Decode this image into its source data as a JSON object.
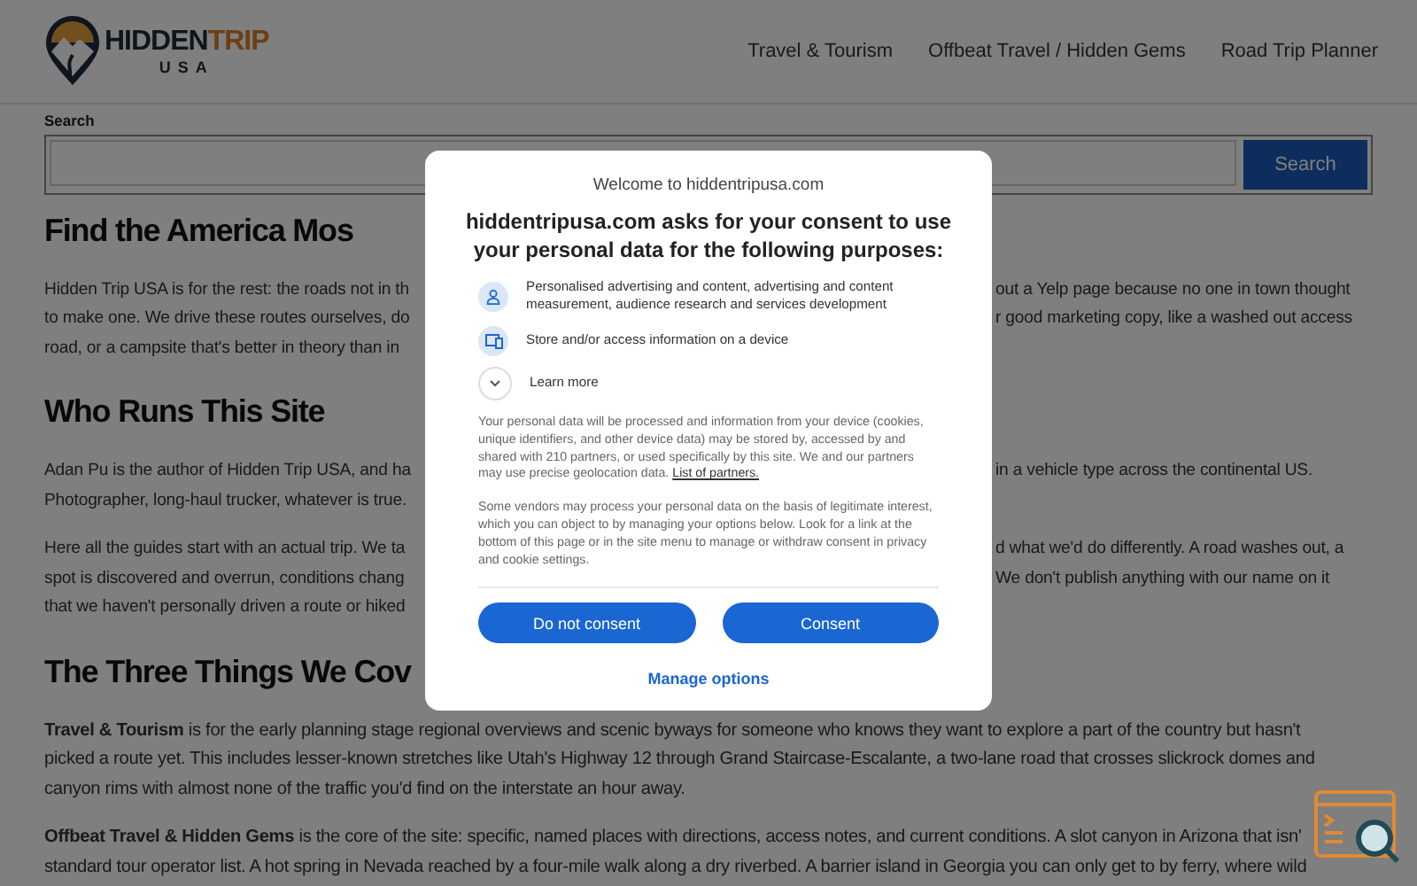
{
  "header": {
    "logo": {
      "word_1": "HIDDEN",
      "word_2": "TRIP",
      "word_3": "USA"
    },
    "nav": [
      "Travel & Tourism",
      "Offbeat Travel / Hidden Gems",
      "Road Trip Planner"
    ]
  },
  "search": {
    "label": "Search",
    "button": "Search"
  },
  "blocks": [
    {
      "kind": "heading",
      "text": "Find the America Mos"
    },
    {
      "kind": "paragraph",
      "lines": [
        {
          "left": "Hidden Trip USA is for the rest: the roads not in th",
          "right": "out a Yelp page because no one in town thought"
        },
        {
          "left": "to make one. We drive these routes ourselves, do",
          "right": "r good marketing copy, like a washed out access"
        },
        {
          "left": "road, or a campsite that's better in theory than in"
        }
      ]
    },
    {
      "kind": "heading",
      "text": "Who Runs This Site"
    },
    {
      "kind": "paragraph",
      "lines": [
        {
          "left": "Adan Pu is the author of Hidden Trip USA, and ha",
          "right": "in a vehicle type across the continental US."
        },
        {
          "left": "Photographer, long-haul trucker, whatever is true."
        }
      ]
    },
    {
      "kind": "paragraph",
      "lines": [
        {
          "left": "Here all the guides start with an actual trip. We ta",
          "right": "d what we'd do differently. A road washes out, a"
        },
        {
          "left": "spot is discovered and overrun, conditions chang",
          "right": "We don't publish anything with our name on it"
        },
        {
          "left": "that we haven't personally driven a route or hiked"
        }
      ]
    },
    {
      "kind": "heading",
      "text": "The Three Things We Cov"
    },
    {
      "kind": "paragraph",
      "lines": [
        {
          "text": "**Travel & Tourism** is for the early planning stage regional overviews and scenic byways for someone who knows they want to explore a part of the country but hasn't"
        },
        {
          "text": "picked a route yet. This includes lesser-known stretches like Utah's Highway 12 through Grand Staircase-Escalante, a two-lane road that crosses slickrock domes and"
        },
        {
          "text": "canyon rims with almost none of the traffic you'd find on the interstate an hour away."
        }
      ]
    },
    {
      "kind": "paragraph",
      "lines": [
        {
          "text": "**Offbeat Travel & Hidden Gems** is the core of the site: specific, named places with directions, access notes, and current conditions. A slot canyon in Arizona that isn'"
        },
        {
          "text": "standard tour operator list. A hot spring in Nevada reached by a four-mile walk along a dry riverbed. A barrier island in Georgia you can only get to by ferry, where wild"
        }
      ]
    }
  ],
  "consent": {
    "welcome": "Welcome to hiddentripusa.com",
    "title": "hiddentripusa.com asks for your consent to use your personal data for the following purposes:",
    "purposes": [
      {
        "kind": "person",
        "text": "Personalised advertising and content, advertising and content measurement, audience research and services development"
      },
      {
        "kind": "device",
        "text": "Store and/or access information on a device"
      },
      {
        "kind": "expand",
        "text": "Learn more"
      }
    ],
    "notice": "Your personal data will be processed and information from your device (cookies, unique identifiers, and other device data) may be stored by, accessed by and shared with 210 partners, or used specifically by this site. We and our partners may use precise geolocation data.",
    "notice_link": "List of partners.",
    "vendors": "Some vendors may process your personal data on the basis of legitimate interest, which you can object to by managing your options below. Look for a link at the bottom of this page or in the site menu to manage or withdraw consent in privacy and cookie settings.",
    "buttons": [
      "Do not consent",
      "Consent"
    ],
    "manage": "Manage options"
  }
}
